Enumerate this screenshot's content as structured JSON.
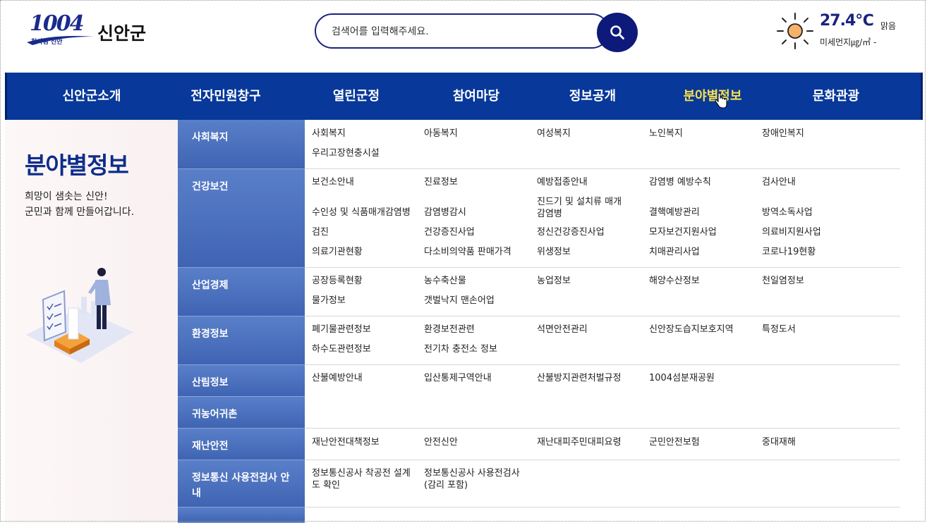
{
  "header": {
    "logo_number": "1004",
    "logo_sub": "천사섬 신안",
    "logo_name": "신안군",
    "search_placeholder": "검색어를 입력해주세요.",
    "temperature": "27.4℃",
    "condition": "맑음",
    "dust": "미세먼지㎍/㎥ -"
  },
  "nav": [
    "신안군소개",
    "전자민원창구",
    "열린군정",
    "참여마당",
    "정보공개",
    "분야별정보",
    "문화관광"
  ],
  "nav_active": "분야별정보",
  "side": {
    "title": "분야별정보",
    "desc_line1": "희망이 샘솟는 신안!",
    "desc_line2": "군민과 함께 만들어갑니다."
  },
  "categories": [
    {
      "name": "사회복지",
      "links": [
        "사회복지",
        "아동복지",
        "여성복지",
        "노인복지",
        "장애인복지",
        "우리고장현충시설"
      ]
    },
    {
      "name": "건강보건",
      "links": [
        "보건소안내",
        "진료정보",
        "예방접종안내",
        "감염병 예방수칙",
        "검사안내",
        "수인성 및 식품매개감염병",
        "감염병감시",
        "진드기 및 설치류 매개 감염병",
        "결핵예방관리",
        "방역소독사업",
        "검진",
        "건강증진사업",
        "정신건강증진사업",
        "모자보건지원사업",
        "의료비지원사업",
        "의료기관현황",
        "다소비의약품 판매가격",
        "위생정보",
        "치매관리사업",
        "코로나19현황"
      ]
    },
    {
      "name": "산업경제",
      "links": [
        "공장등록현황",
        "농수축산물",
        "농업정보",
        "해양수산정보",
        "천일염정보",
        "물가정보",
        "갯벌낙지 맨손어업"
      ]
    },
    {
      "name": "환경정보",
      "links": [
        "폐기물관련정보",
        "환경보전관련",
        "석면안전관리",
        "신안장도습지보호지역",
        "특정도서",
        "하수도관련정보",
        "전기차 충전소 정보"
      ]
    },
    {
      "name": "산림정보",
      "links": [
        "산불예방안내",
        "입산통제구역안내",
        "산불방지관련처벌규정",
        "1004섬분재공원"
      ]
    },
    {
      "name": "귀농어귀촌",
      "links": []
    },
    {
      "name": "재난안전",
      "links": [
        "재난안전대책정보",
        "안전신안",
        "재난대피주민대피요령",
        "군민안전보험",
        "중대재해"
      ]
    },
    {
      "name": "정보통신 사용전검사 안내",
      "links": [
        "정보통신공사 착공전 설계도 확인",
        "정보통신공사 사용전검사 (감리 포함)"
      ]
    }
  ]
}
